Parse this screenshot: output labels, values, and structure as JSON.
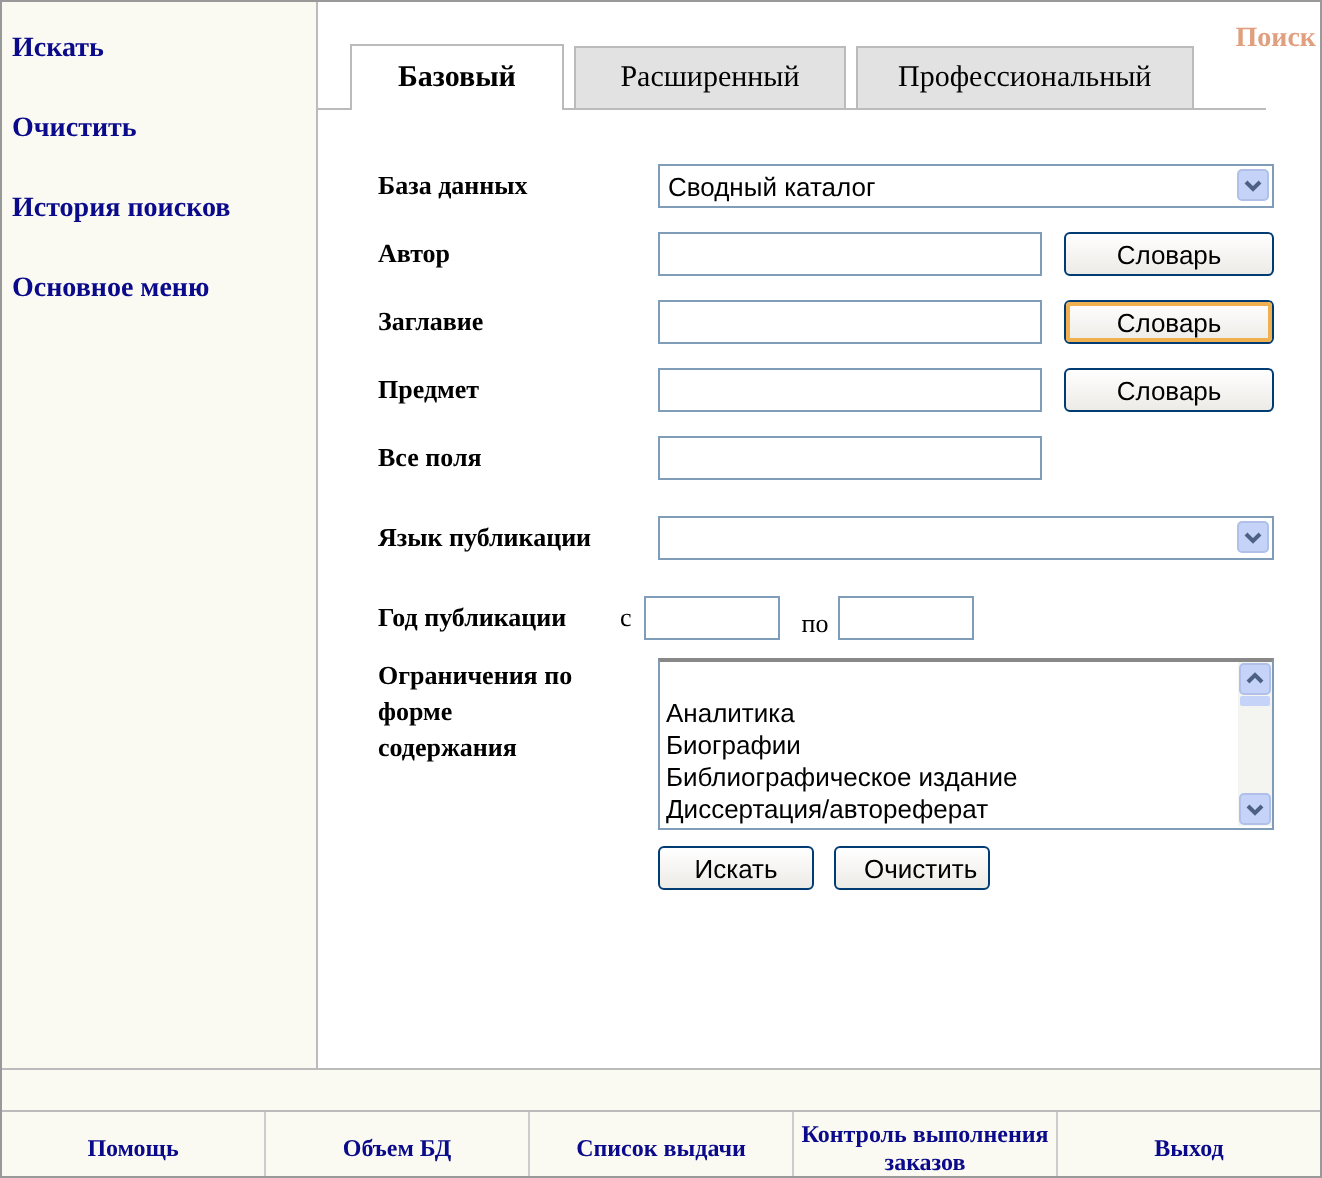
{
  "sidebar": {
    "items": [
      {
        "label": "Искать"
      },
      {
        "label": "Очистить"
      },
      {
        "label": "История поисков"
      },
      {
        "label": "Основное меню"
      }
    ]
  },
  "corner_title": "Поиск",
  "tabs": [
    {
      "label": "Базовый",
      "selected": true
    },
    {
      "label": "Расширенный",
      "selected": false
    },
    {
      "label": "Профессиональный",
      "selected": false
    }
  ],
  "form": {
    "rows": [
      {
        "kind": "select",
        "label": "База данных",
        "value": "Сводный каталог"
      },
      {
        "kind": "text",
        "label": "Автор",
        "button": {
          "label": "Словарь",
          "focused": false
        }
      },
      {
        "kind": "text",
        "label": "Заглавие",
        "button": {
          "label": "Словарь",
          "focused": true
        }
      },
      {
        "kind": "text",
        "label": "Предмет",
        "button": {
          "label": "Словарь",
          "focused": false
        }
      },
      {
        "kind": "text",
        "label": "Все поля"
      },
      {
        "kind": "select",
        "label": "Язык публикации"
      },
      {
        "kind": "range",
        "label": "Год публикации",
        "from": "с",
        "to": "по"
      },
      {
        "kind": "list",
        "label": "Ограничения по форме содержания",
        "options": [
          "Аналитика",
          "Биографии",
          "Библиографическое издание",
          "Диссертация/автореферат"
        ]
      }
    ],
    "actions": [
      "Искать",
      "Очистить"
    ]
  },
  "footer": [
    "Помощь",
    "Объем БД",
    "Список выдачи",
    "Контроль выполнения заказов",
    "Выход"
  ]
}
